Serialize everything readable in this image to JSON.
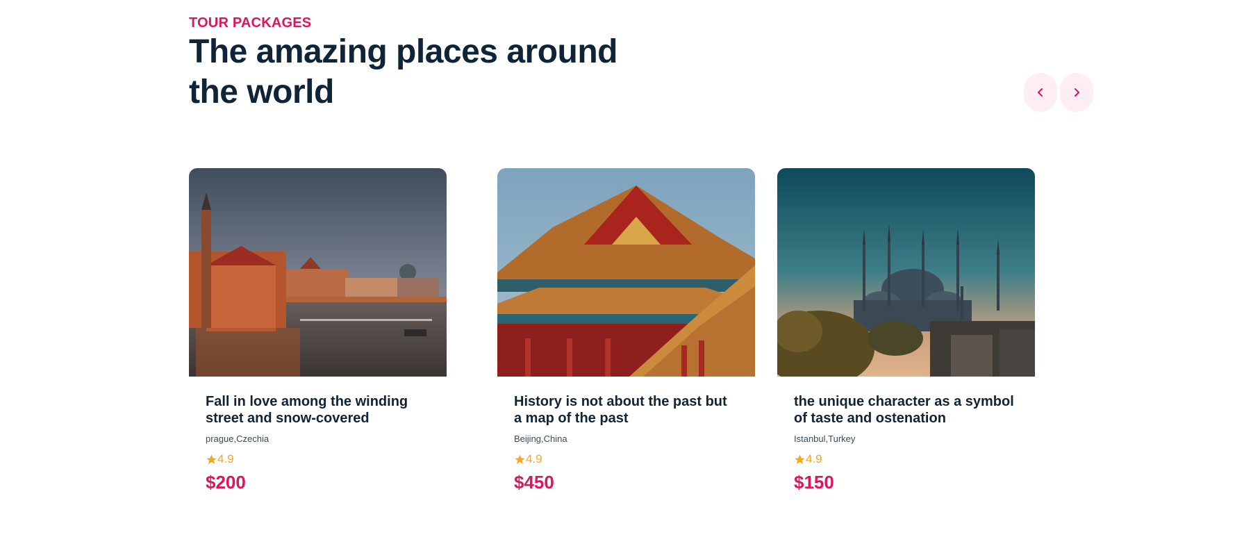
{
  "section": {
    "eyebrow": "TOUR PACKAGES",
    "headline": "The amazing places around the world"
  },
  "nav": {
    "prev_icon": "chevron-left-icon",
    "next_icon": "chevron-right-icon"
  },
  "colors": {
    "accent": "#e0135f",
    "heading": "#0f2436",
    "rating": "#f5a623",
    "nav_bg": "#fdeef3"
  },
  "packages": [
    {
      "title": "Fall in love among the winding street and snow-covered",
      "location": "prague,Czechia",
      "rating": "4.9",
      "price": "$200",
      "image": "prague-riverside-photo"
    },
    {
      "title": "History is not about the past but a map of the past",
      "location": "Beijing,China",
      "rating": "4.9",
      "price": "$450",
      "image": "forbidden-city-roof-photo"
    },
    {
      "title": "the unique character as a symbol of taste and ostenation",
      "location": "Istanbul,Turkey",
      "rating": "4.9",
      "price": "$150",
      "image": "blue-mosque-skyline-photo"
    }
  ]
}
